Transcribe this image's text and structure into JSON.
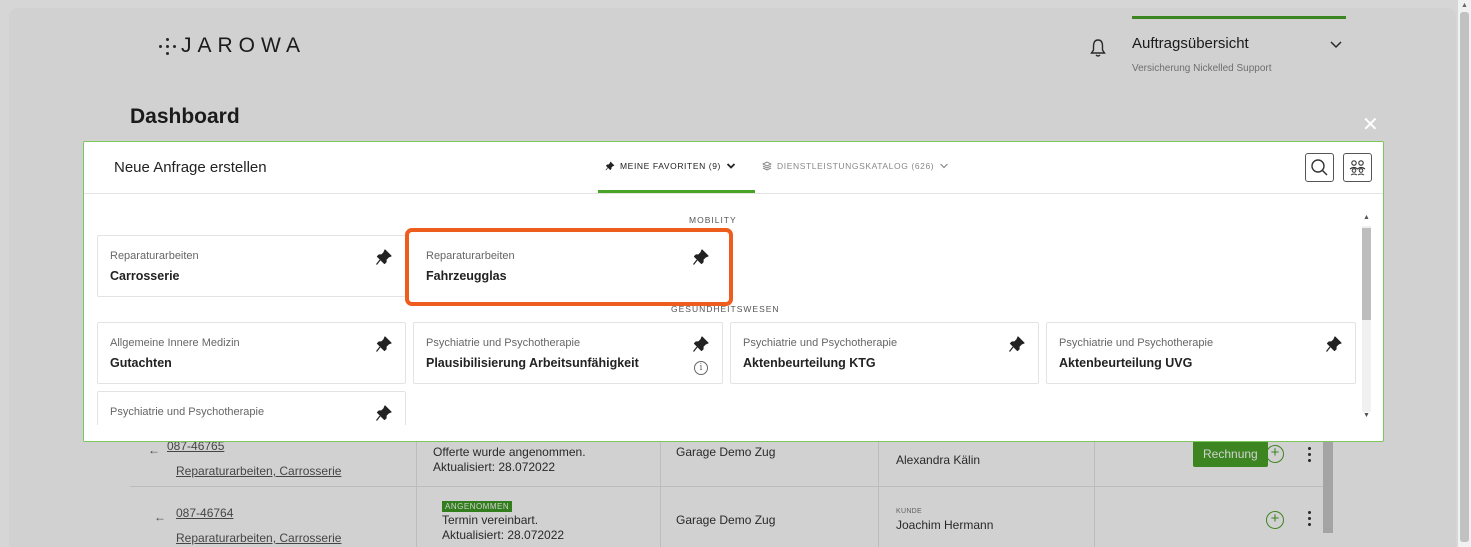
{
  "app": {
    "logo_text": "JAROWA",
    "header": {
      "order_title": "Auftragsübersicht",
      "order_subtitle": "Versicherung Nickelled Support"
    },
    "dashboard_title": "Dashboard"
  },
  "background_rows": [
    {
      "order_id": "087-46765",
      "service": "Reparaturarbeiten, Carrosserie",
      "status_line1": "Offerte wurde angenommen.",
      "status_line2": "Aktualisiert: 28.072022",
      "garage": "Garage Demo Zug",
      "customer": "Alexandra Kälin",
      "action": "Rechnung"
    },
    {
      "order_id": "087-46764",
      "service": "Reparaturarbeiten, Carrosserie",
      "status_badge": "ANGENOMMEN",
      "status_line1": "Termin vereinbart.",
      "status_line2": "Aktualisiert: 28.072022",
      "garage": "Garage Demo Zug",
      "customer_label": "KUNDE",
      "customer": "Joachim Hermann"
    }
  ],
  "modal": {
    "title": "Neue Anfrage erstellen",
    "tabs": {
      "favorites": "MEINE FAVORITEN (9)",
      "catalog": "DIENSTLEISTUNGSKATALOG (626)"
    },
    "sections": {
      "mobility": "MOBILITY",
      "health": "GESUNDHEITSWESEN"
    },
    "mobility_cards": [
      {
        "category": "Reparaturarbeiten",
        "name": "Carrosserie"
      },
      {
        "category": "Reparaturarbeiten",
        "name": "Fahrzeugglas"
      }
    ],
    "health_cards": [
      {
        "category": "Allgemeine Innere Medizin",
        "name": "Gutachten"
      },
      {
        "category": "Psychiatrie und Psychotherapie",
        "name": "Plausibilisierung Arbeitsunfähigkeit"
      },
      {
        "category": "Psychiatrie und Psychotherapie",
        "name": "Aktenbeurteilung KTG"
      },
      {
        "category": "Psychiatrie und Psychotherapie",
        "name": "Aktenbeurteilung UVG"
      },
      {
        "category": "Psychiatrie und Psychotherapie",
        "name": ""
      }
    ]
  },
  "colors": {
    "accent": "#4aa329",
    "highlight": "#ee5d1e"
  },
  "icons": [
    "bell-icon",
    "chevron-down-icon",
    "close-icon",
    "pin-icon",
    "info-icon",
    "search-icon",
    "people-icon",
    "catalog-icon",
    "arrow-left-icon",
    "plus-circle-icon",
    "kebab-icon"
  ]
}
